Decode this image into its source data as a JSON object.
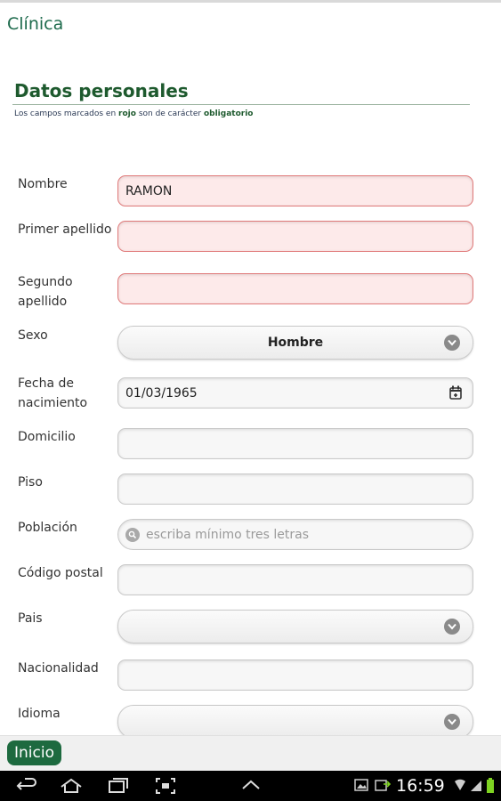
{
  "app": {
    "title": "Clínica"
  },
  "section": {
    "title": "Datos personales",
    "note_prefix": "Los campos marcados en",
    "note_red": "rojo",
    "note_middle": "son de carácter",
    "note_bold": "obligatorio"
  },
  "form": {
    "nombre": {
      "label": "Nombre",
      "value": "RAMON"
    },
    "primer_apellido": {
      "label": "Primer apellido",
      "value": ""
    },
    "segundo_apellido": {
      "label": "Segundo apellido",
      "value": ""
    },
    "sexo": {
      "label": "Sexo",
      "value": "Hombre"
    },
    "fecha_nacimiento": {
      "label": "Fecha de nacimiento",
      "value": "01/03/1965"
    },
    "domicilio": {
      "label": "Domicilio",
      "value": ""
    },
    "piso": {
      "label": "Piso",
      "value": ""
    },
    "poblacion": {
      "label": "Población",
      "placeholder": "escriba mínimo tres letras"
    },
    "codigo_postal": {
      "label": "Código postal",
      "value": ""
    },
    "pais": {
      "label": "Pais",
      "value": ""
    },
    "nacionalidad": {
      "label": "Nacionalidad",
      "value": ""
    },
    "idioma": {
      "label": "Idioma",
      "value": ""
    }
  },
  "footer": {
    "home_label": "Inicio"
  },
  "status": {
    "time": "16:59"
  },
  "colors": {
    "brand": "#1d6a3f",
    "required_bg": "#fdeaea",
    "required_border": "#e07a7a"
  }
}
